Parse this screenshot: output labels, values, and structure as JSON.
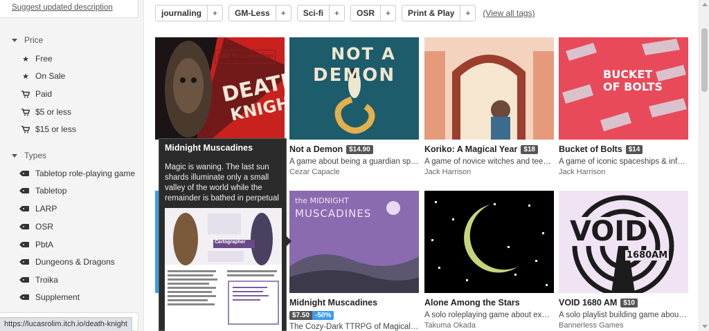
{
  "sidebar": {
    "suggest_link": "Suggest updated description",
    "price": {
      "heading": "Price",
      "items": [
        {
          "label": "Free",
          "icon": "star-icon"
        },
        {
          "label": "On Sale",
          "icon": "star-icon"
        },
        {
          "label": "Paid",
          "icon": "cart-icon"
        },
        {
          "label": "$5 or less",
          "icon": "cart-icon"
        },
        {
          "label": "$15 or less",
          "icon": "cart-icon"
        }
      ]
    },
    "types": {
      "heading": "Types",
      "items": [
        {
          "label": "Tabletop role-playing game"
        },
        {
          "label": "Tabletop"
        },
        {
          "label": "LARP"
        },
        {
          "label": "OSR"
        },
        {
          "label": "PbtA"
        },
        {
          "label": "Dungeons & Dragons"
        },
        {
          "label": "Troika"
        },
        {
          "label": "Supplement"
        }
      ]
    }
  },
  "status_url": "https://lucasrolim.itch.io/death-knight",
  "tags": [
    {
      "name": "journaling",
      "plus": "+"
    },
    {
      "name": "GM-Less",
      "plus": "+"
    },
    {
      "name": "Sci-fi",
      "plus": "+"
    },
    {
      "name": "OSR",
      "plus": "+"
    },
    {
      "name": "Print & Play",
      "plus": "+"
    }
  ],
  "view_all_tags": "(View all tags)",
  "add_to_collection": "Add to collection",
  "games": [
    {
      "cover_text_1": "DEATH",
      "cover_text_2": "KNIGHT"
    },
    {
      "title": "Not a Demon",
      "price": "$14.90",
      "desc": "A game about being a guardian spirit...",
      "author": "Cezar Capacle",
      "cover_text_1": "NOT A",
      "cover_text_2": "DEMON"
    },
    {
      "title": "Koriko: A Magical Year",
      "price": "$18",
      "desc": "A game of novice witches and teena...",
      "author": "Jack Harrison"
    },
    {
      "title": "Bucket of Bolts",
      "price": "$14",
      "desc": "A game of iconic spaceships & infam...",
      "author": "Jack Harrison",
      "cover_text_1": "BUCKET",
      "cover_text_2": "OF BOLTS"
    },
    {
      "title": "Midnight Muscadines",
      "price": "$7.50",
      "sale": "-50%",
      "desc": "The Cozy-Dark TTRPG of Magical Ja...",
      "cover_text_1": "the MIDNIGHT",
      "cover_text_2": "MUSCADINES"
    },
    {
      "title": "Alone Among the Stars",
      "desc": "A solo roleplaying game about explo...",
      "author": "Takuma Okada"
    },
    {
      "title": "VOID 1680 AM",
      "price": "$10",
      "desc": "A solo playlist building game about b...",
      "author": "Bannerless Games",
      "cover_text_1": "VOID",
      "cover_text_2": "1680AM"
    }
  ],
  "tooltip": {
    "title": "Midnight Muscadines",
    "text": "Magic is waning. The last sun shards illuminate only a small valley of the world while the remainder is bathed in perpetual",
    "screenshot_label": "Cartographer"
  }
}
